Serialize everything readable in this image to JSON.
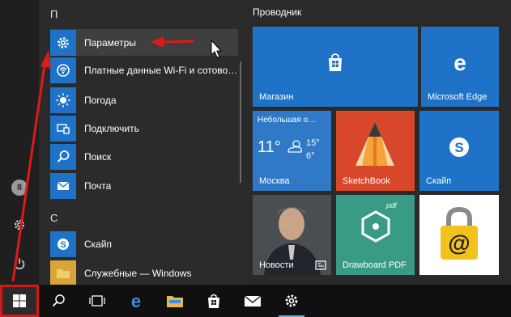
{
  "app_list": {
    "sections": [
      {
        "letter": "П",
        "items": [
          {
            "label": "Параметры",
            "icon": "gear-icon",
            "color": "#1e73c9",
            "selected": true
          },
          {
            "label": "Платные данные Wi-Fi и сотово…",
            "icon": "wifi-icon",
            "color": "#1e73c9"
          },
          {
            "label": "Погода",
            "icon": "sun-icon",
            "color": "#1e73c9"
          },
          {
            "label": "Подключить",
            "icon": "connect-icon",
            "color": "#1e73c9"
          },
          {
            "label": "Поиск",
            "icon": "search-icon",
            "color": "#1e73c9"
          },
          {
            "label": "Почта",
            "icon": "mail-icon",
            "color": "#1e73c9"
          }
        ]
      },
      {
        "letter": "С",
        "items": [
          {
            "label": "Скайп",
            "icon": "skype-icon",
            "color": "#1e73c9"
          },
          {
            "label": "Служебные — Windows",
            "icon": "folder-icon",
            "color": "#e8b84a"
          }
        ]
      }
    ]
  },
  "tiles": {
    "group_title": "Проводник",
    "store": {
      "label": "Магазин",
      "color": "#1e73c9"
    },
    "edge": {
      "label": "Microsoft Edge",
      "color": "#1e73c9"
    },
    "weather": {
      "condition": "Небольшая о…",
      "temp_current": "11°",
      "temp_high": "15°",
      "temp_low": "6°",
      "city": "Москва",
      "color": "#1e73c9"
    },
    "sketchbook": {
      "label": "SketchBook",
      "color": "#d9472b"
    },
    "skype": {
      "label": "Скайп",
      "color": "#1e73c9"
    },
    "news": {
      "label": "Новости",
      "color": "#2b2b2b"
    },
    "drawboard": {
      "label": "Drawboard PDF",
      "color": "#3a9b84",
      "badge": "pdf"
    },
    "keeper": {
      "symbol": "@",
      "color": "#ffffff"
    }
  },
  "rail": {
    "avatar_letter": "8"
  },
  "taskbar": {
    "items": [
      "windows-start",
      "search",
      "task-view",
      "edge",
      "file-explorer",
      "store",
      "mail",
      "settings"
    ]
  }
}
